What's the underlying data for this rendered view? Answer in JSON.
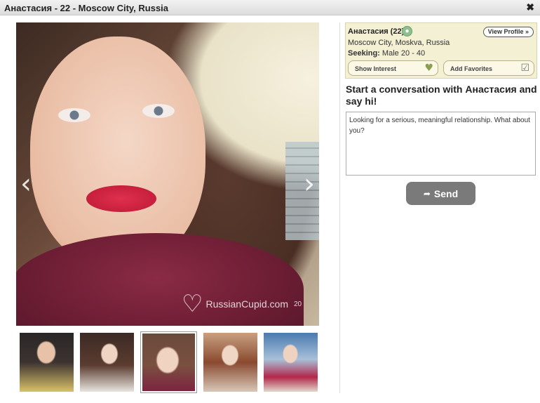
{
  "window": {
    "title": "Анастасия - 22 - Moscow City, Russia",
    "close_glyph": "✖"
  },
  "photo": {
    "prev_glyph": "‹",
    "next_glyph": "›",
    "watermark": "RussianCupid.com",
    "watermark_number": "20"
  },
  "thumbnails": [
    {
      "name": "thumbnail-1",
      "selected": false
    },
    {
      "name": "thumbnail-2",
      "selected": false
    },
    {
      "name": "thumbnail-3",
      "selected": true
    },
    {
      "name": "thumbnail-4",
      "selected": false
    },
    {
      "name": "thumbnail-5",
      "selected": false
    }
  ],
  "profile": {
    "name_age": "Анастасия (22)",
    "view_profile_label": "View Profile »",
    "location": "Moscow City, Moskva, Russia",
    "seeking_label": "Seeking:",
    "seeking_value": "Male 20 - 40",
    "show_interest_label": "Show Interest",
    "add_favorites_label": "Add Favorites"
  },
  "conversation": {
    "heading": "Start a conversation with Анастасия and say hi!",
    "message": "Looking for a serious, meaningful relationship. What about you?",
    "send_label": "Send"
  },
  "colors": {
    "info_bg": "#f4f0d4",
    "send_bg": "#7a7a7a"
  }
}
